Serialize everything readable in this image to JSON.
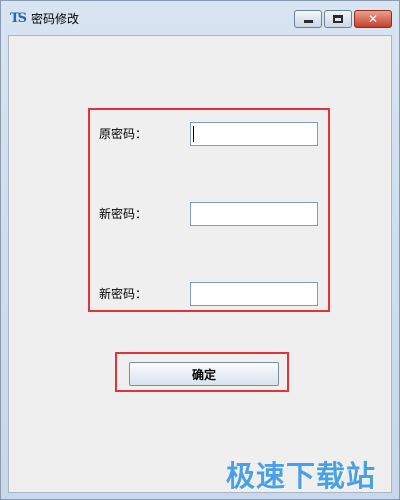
{
  "window": {
    "title": "密码修改",
    "icon": "ts-app-icon"
  },
  "form": {
    "fields": [
      {
        "label": "原密码：",
        "value": ""
      },
      {
        "label": "新密码：",
        "value": ""
      },
      {
        "label": "新密码：",
        "value": ""
      }
    ],
    "confirm_label": "确定"
  },
  "watermark": "极速下载站",
  "colors": {
    "highlight_red": "#e0343a",
    "watermark_blue": "#4aa0e8"
  }
}
